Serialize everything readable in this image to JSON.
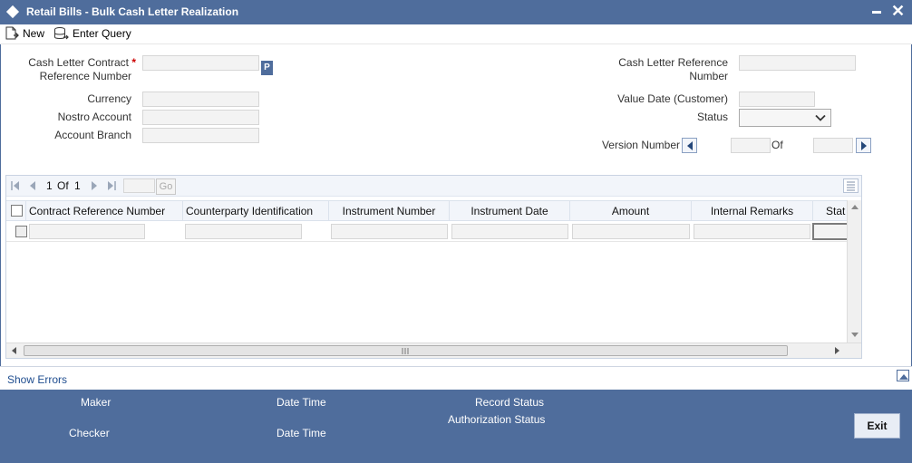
{
  "window": {
    "title": "Retail Bills - Bulk Cash Letter Realization"
  },
  "toolbar": {
    "new_label": "New",
    "enter_query_label": "Enter Query"
  },
  "form": {
    "contract_ref_label_1": "Cash Letter Contract",
    "contract_ref_label_2": "Reference Number",
    "required_mark": "*",
    "lov_label": "P",
    "currency_label": "Currency",
    "nostro_label": "Nostro Account",
    "branch_label": "Account Branch",
    "cash_letter_ref_label_1": "Cash Letter Reference",
    "cash_letter_ref_label_2": "Number",
    "value_date_label": "Value Date (Customer)",
    "status_label": "Status",
    "version_label": "Version Number",
    "of_label": "Of",
    "contract_ref_value": "",
    "currency_value": "",
    "nostro_value": "",
    "branch_value": "",
    "cash_letter_ref_value": "",
    "value_date_value": "",
    "status_value": "",
    "version_current": "",
    "version_total": ""
  },
  "grid": {
    "pager": {
      "current": "1",
      "of": "Of",
      "total": "1",
      "go": "Go"
    },
    "columns": [
      "Contract Reference Number",
      "Counterparty Identification",
      "Instrument Number",
      "Instrument Date",
      "Amount",
      "Internal Remarks",
      "Stat"
    ]
  },
  "errors": {
    "show_errors_label": "Show Errors"
  },
  "footer": {
    "maker_label": "Maker",
    "date_time_label_1": "Date Time",
    "record_status_label": "Record Status",
    "authorization_status_label": "Authorization Status",
    "checker_label": "Checker",
    "date_time_label_2": "Date Time",
    "exit_label": "Exit"
  },
  "colors": {
    "brand": "#4f6d9c",
    "required": "#cc0000",
    "link": "#1f4d8f"
  },
  "icons": [
    "window-diamond-icon",
    "minimize-icon",
    "close-icon",
    "new-icon",
    "enter-query-icon",
    "lov-icon",
    "chevron-down-icon",
    "previous-icon",
    "next-icon",
    "first-page-icon",
    "prev-page-icon",
    "next-page-icon",
    "last-page-icon",
    "grid-options-icon",
    "collapse-up-icon"
  ]
}
